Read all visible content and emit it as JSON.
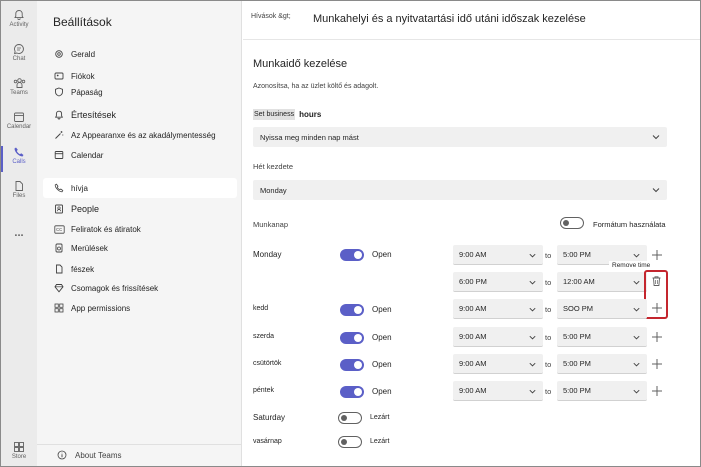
{
  "rail": {
    "items": [
      {
        "label": "Activity",
        "icon": "bell-icon"
      },
      {
        "label": "Chat",
        "icon": "chat-icon"
      },
      {
        "label": "Teams",
        "icon": "teams-icon"
      },
      {
        "label": "Calendar",
        "icon": "calendar-icon"
      },
      {
        "label": "Calls",
        "icon": "phone-icon"
      },
      {
        "label": "Files",
        "icon": "file-icon"
      },
      {
        "label": "...",
        "icon": "more-icon"
      },
      {
        "label": "Store",
        "icon": "apps-icon"
      }
    ],
    "active_color": "#5b5fc7"
  },
  "sidebar": {
    "title": "Beállítások",
    "items": [
      {
        "label": "Gerald",
        "icon": "gear-icon"
      },
      {
        "label": "Fiókok",
        "icon": "account-icon"
      },
      {
        "label": "Pápaság",
        "icon": "shield-icon"
      },
      {
        "label": "Értesítések",
        "icon": "bell-icon"
      },
      {
        "label": "Az Appearanxe és az akadálymentesség",
        "icon": "wand-icon"
      },
      {
        "label": "Calendar",
        "icon": "calendar-icon"
      },
      {
        "label": "hívja",
        "icon": "phone-icon"
      },
      {
        "label": "People",
        "icon": "people-icon"
      },
      {
        "label": "Feliratok és átiratok",
        "icon": "cc-icon"
      },
      {
        "label": "Merülések",
        "icon": "devices-icon"
      },
      {
        "label": "fészek",
        "icon": "file-icon"
      },
      {
        "label": "Csomagok és frissítések",
        "icon": "diamond-icon"
      },
      {
        "label": "App  permissions",
        "icon": "grid-icon"
      }
    ],
    "footer": "About Teams"
  },
  "header": {
    "breadcrumb": "Hívások &gt;",
    "title": "Munkahelyi és a nyitvatartási idő utáni időszak kezelése"
  },
  "section": {
    "title": "Munkaidő kezelése",
    "description": "Azonosítsa, ha az üzlet költő és adagolt.",
    "set_business_label": "Set business",
    "hours_label": "hours",
    "hours_dropdown": "Nyissa meg minden nap mást",
    "week_start_label": "Hét kezdete",
    "week_start_value": "Monday",
    "workday_label": "Munkanap",
    "format_label": "Formátum használata",
    "to_label": "to",
    "tooltip": "Remove time",
    "accent_color": "#5b5fc7",
    "highlight_color": "#c4262e"
  },
  "days": [
    {
      "name": "Monday",
      "status": "Open",
      "from": "9:00 AM",
      "to": "5:00 PM",
      "extra_from": "6:00 PM",
      "extra_to": "12:00 AM"
    },
    {
      "name": "kedd",
      "status": "Open",
      "from": "9:00 AM",
      "to": "SOO PM"
    },
    {
      "name": "szerda",
      "status": "Open",
      "from": "9:00 AM",
      "to": "5:00 PM"
    },
    {
      "name": "csütörtök",
      "status": "Open",
      "from": "9:00 AM",
      "to": "5:00 PM"
    },
    {
      "name": "péntek",
      "status": "Open",
      "from": "9:00 AM",
      "to": "5:00 PM"
    },
    {
      "name": "Saturday",
      "status": "Lezárt"
    },
    {
      "name": "vasárnap",
      "status": "Lezárt"
    }
  ]
}
